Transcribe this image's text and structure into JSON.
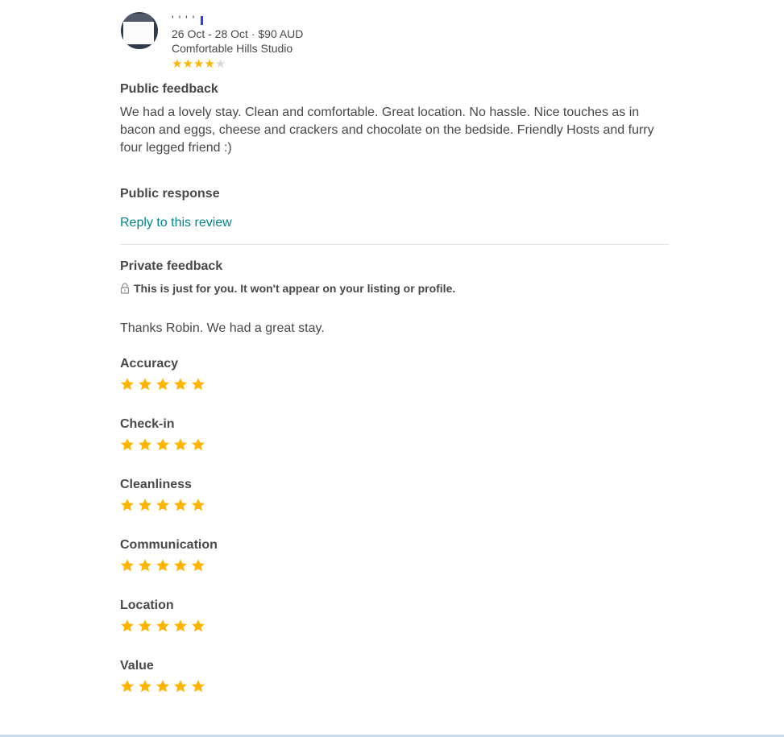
{
  "review": {
    "reviewer_name": "' ' ' ' ",
    "stay_dates": "26 Oct - 28 Oct · $90 AUD",
    "listing_name": "Comfortable Hills Studio",
    "overall_rating": 4,
    "overall_out_of": 5
  },
  "public": {
    "title": "Public feedback",
    "text": "We had a lovely stay. Clean and comfortable. Great location. No hassle. Nice touches as in bacon and eggs, cheese and crackers and chocolate on the bedside. Friendly Hosts and furry four legged friend :)"
  },
  "response": {
    "title": "Public response",
    "reply_label": "Reply to this review"
  },
  "private": {
    "title": "Private feedback",
    "note": "This is just for you. It won't appear on your listing or profile.",
    "text": "Thanks Robin. We had a great stay.",
    "icon": "lock-icon"
  },
  "categories": [
    {
      "label": "Accuracy",
      "rating": 5
    },
    {
      "label": "Check-in",
      "rating": 5
    },
    {
      "label": "Cleanliness",
      "rating": 5
    },
    {
      "label": "Communication",
      "rating": 5
    },
    {
      "label": "Location",
      "rating": 5
    },
    {
      "label": "Value",
      "rating": 5
    }
  ],
  "colors": {
    "star": "#ffb400",
    "star_empty": "#d8d8d8",
    "link": "#008489",
    "text": "#484848"
  }
}
